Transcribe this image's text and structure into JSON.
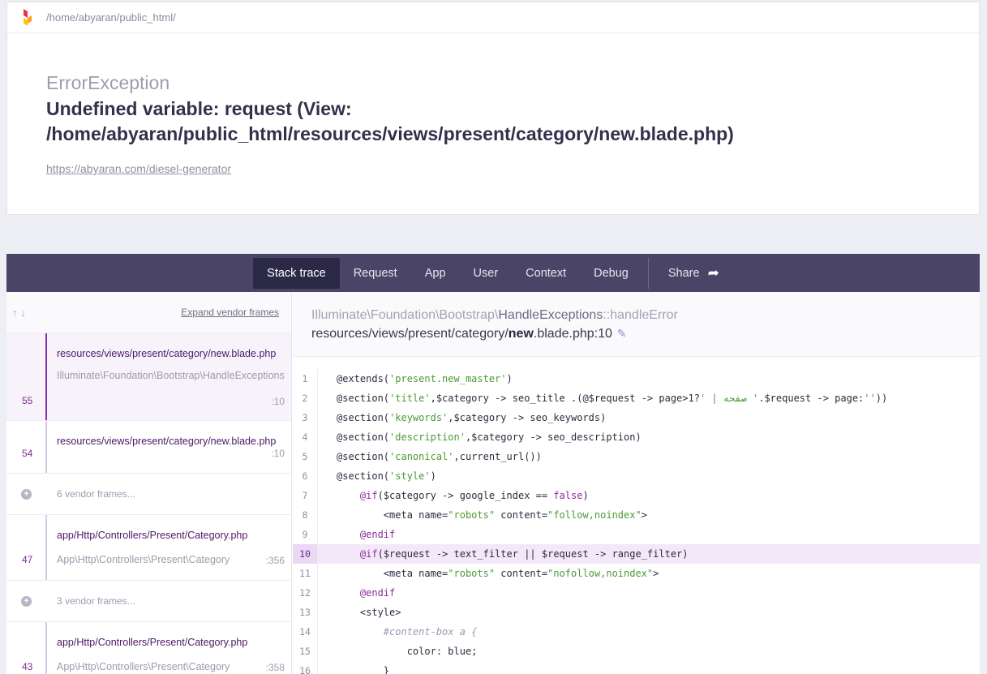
{
  "header": {
    "path": "/home/abyaran/public_html/"
  },
  "exception": {
    "class": "ErrorException",
    "message": "Undefined variable: request (View: /home/abyaran/public_html/resources/views/present/category/new.blade.php)",
    "url": "https://abyaran.com/diesel-generator"
  },
  "tabs": [
    "Stack trace",
    "Request",
    "App",
    "User",
    "Context",
    "Debug"
  ],
  "share_label": "Share",
  "sidebar": {
    "expand_label": "Expand vendor frames",
    "frames": [
      {
        "number": "55",
        "file": "resources/views/present/category/new.blade.php",
        "class": "Illuminate\\Foundation\\Bootstrap\\HandleExceptions",
        "line": ":10"
      },
      {
        "number": "54",
        "file": "resources/views/present/category/new.blade.php",
        "line": ":10"
      },
      {
        "vendor": "6 vendor frames..."
      },
      {
        "number": "47",
        "file": "app/Http/Controllers/Present/Category.php",
        "class": "App\\Http\\Controllers\\Present\\Category",
        "line": ":356"
      },
      {
        "vendor": "3 vendor frames..."
      },
      {
        "number": "43",
        "file": "app/Http/Controllers/Present/Category.php",
        "class": "App\\Http\\Controllers\\Present\\Category",
        "line": ":358"
      }
    ]
  },
  "code_header": {
    "class_prefix": "Illuminate\\Foundation\\Bootstrap\\",
    "class_name": "HandleExceptions",
    "method": "::handleError",
    "file_path": "resources/views/present/category/",
    "file_name": "new",
    "file_suffix": ".blade.php:10"
  },
  "code_lines": [
    {
      "n": "1",
      "html": "@extends(<span class=\"str\">'present.new_master'</span>)"
    },
    {
      "n": "2",
      "html": "@section(<span class=\"str\">'title'</span>,$category -> seo_title .(@$request -> page>1?<span class=\"str\">' | صفحه '</span>.$request -> page:<span class=\"str\">''</span>))"
    },
    {
      "n": "3",
      "html": "@section(<span class=\"str\">'keywords'</span>,$category -> seo_keywords)"
    },
    {
      "n": "4",
      "html": "@section(<span class=\"str\">'description'</span>,$category -> seo_description)"
    },
    {
      "n": "5",
      "html": "@section(<span class=\"str\">'canonical'</span>,current_url())"
    },
    {
      "n": "6",
      "html": "@section(<span class=\"str\">'style'</span>)"
    },
    {
      "n": "7",
      "html": "    <span class=\"kw\">@if</span>($category -> google_index == <span class=\"kw\">false</span>)"
    },
    {
      "n": "8",
      "html": "        &lt;meta name=<span class=\"str\">\"robots\"</span> content=<span class=\"str\">\"follow,noindex\"</span>&gt;"
    },
    {
      "n": "9",
      "html": "    <span class=\"kw\">@endif</span>"
    },
    {
      "n": "10",
      "html": "    <span class=\"kw\">@if</span>($request -> text_filter || $request -> range_filter)"
    },
    {
      "n": "11",
      "html": "        &lt;meta name=<span class=\"str\">\"robots\"</span> content=<span class=\"str\">\"nofollow,noindex\"</span>&gt;"
    },
    {
      "n": "12",
      "html": "    <span class=\"kw\">@endif</span>"
    },
    {
      "n": "13",
      "html": "    &lt;style&gt;"
    },
    {
      "n": "14",
      "html": "        <span class=\"cm\">#content-box a {</span>"
    },
    {
      "n": "15",
      "html": "            color: blue;"
    },
    {
      "n": "16",
      "html": "        }"
    }
  ],
  "highlight_line": "10",
  "colors": {
    "tabbar": "#4a4566",
    "active_tab": "#2c2947",
    "accent": "#8d2ea5"
  }
}
